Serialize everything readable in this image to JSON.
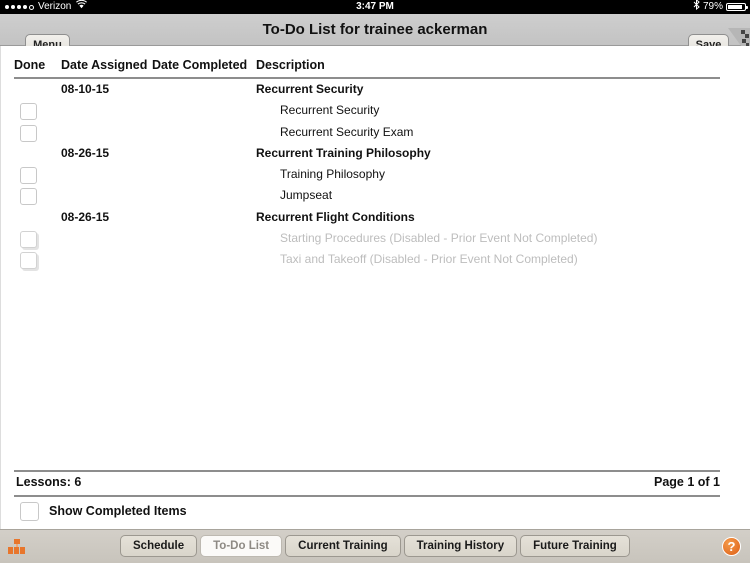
{
  "statusbar": {
    "carrier": "Verizon",
    "time": "3:47 PM",
    "battery_percent": "79%",
    "signal_icon": "signal-dots-icon",
    "wifi_icon": "wifi-icon",
    "bluetooth_icon": "bluetooth-icon",
    "battery_icon": "battery-icon"
  },
  "titlebar": {
    "menu_label": "Menu",
    "title": "To-Do List for trainee ackerman",
    "save_label": "Save",
    "corner_icon": "page-fold-icon"
  },
  "table": {
    "headers": {
      "done": "Done",
      "date_assigned": "Date Assigned",
      "date_completed": "Date Completed",
      "description": "Description"
    },
    "rows": [
      {
        "type": "group",
        "date": "08-10-15",
        "description": "Recurrent Security"
      },
      {
        "type": "child",
        "date": "",
        "description": "Recurrent Security"
      },
      {
        "type": "child",
        "date": "",
        "description": "Recurrent Security Exam"
      },
      {
        "type": "group",
        "date": "08-26-15",
        "description": "Recurrent Training Philosophy"
      },
      {
        "type": "child",
        "date": "",
        "description": "Training Philosophy"
      },
      {
        "type": "child",
        "date": "",
        "description": "Jumpseat"
      },
      {
        "type": "group",
        "date": "08-26-15",
        "description": "Recurrent Flight Conditions"
      },
      {
        "type": "disabled",
        "date": "",
        "description": "Starting Procedures (Disabled - Prior Event Not Completed)"
      },
      {
        "type": "disabled",
        "date": "",
        "description": "Taxi and Takeoff (Disabled - Prior Event Not Completed)"
      }
    ]
  },
  "footer": {
    "lessons": "Lessons: 6",
    "page": "Page 1 of 1",
    "show_completed_label": "Show Completed Items"
  },
  "tabbar": {
    "tabs": [
      {
        "label": "Schedule",
        "active": false
      },
      {
        "label": "To-Do List",
        "active": true
      },
      {
        "label": "Current Training",
        "active": false
      },
      {
        "label": "Training History",
        "active": false
      },
      {
        "label": "Future Training",
        "active": false
      }
    ],
    "grid_icon": "app-grid-icon",
    "help_label": "?",
    "help_icon": "help-question-icon"
  },
  "colors": {
    "accent_orange": "#e8762c",
    "titlebar_grey": "#c8c8c8",
    "disabled_text": "#bdbdbd"
  }
}
